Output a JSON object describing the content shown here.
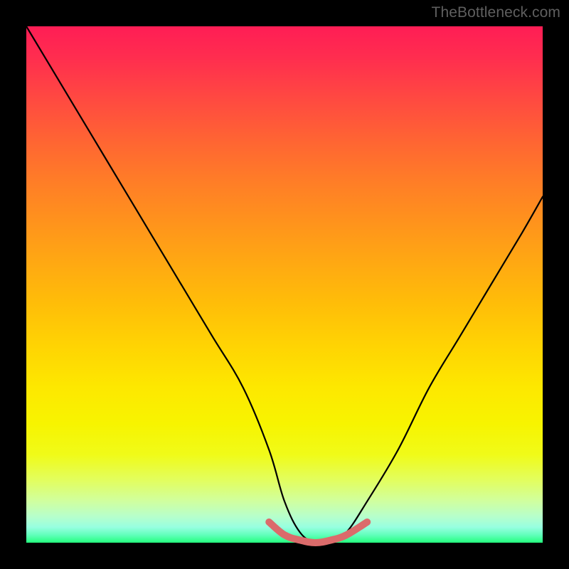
{
  "watermark": "TheBottleneck.com",
  "colors": {
    "curve_stroke": "#000000",
    "tolerance_stroke": "#db6b6b",
    "gradient_top": "#ff1d55",
    "gradient_bottom": "#24ff7e",
    "background": "#000000"
  },
  "chart_data": {
    "type": "line",
    "title": "",
    "xlabel": "",
    "ylabel": "",
    "xlim": [
      0,
      100
    ],
    "ylim": [
      0,
      100
    ],
    "grid": false,
    "legend": false,
    "series": [
      {
        "name": "bottleneck-curve",
        "x": [
          0,
          6,
          12,
          18,
          24,
          30,
          36,
          42,
          47,
          50,
          53,
          56,
          59,
          62,
          66,
          72,
          78,
          84,
          90,
          96,
          100
        ],
        "values": [
          100,
          90,
          80,
          70,
          60,
          50,
          40,
          30,
          18,
          8,
          2,
          0,
          0,
          2,
          8,
          18,
          30,
          40,
          50,
          60,
          67
        ]
      },
      {
        "name": "tolerance-band",
        "x": [
          47,
          50,
          53,
          56,
          59,
          62,
          66
        ],
        "values": [
          4,
          1.5,
          0.5,
          0,
          0.5,
          1.5,
          4
        ]
      }
    ],
    "annotations": []
  }
}
